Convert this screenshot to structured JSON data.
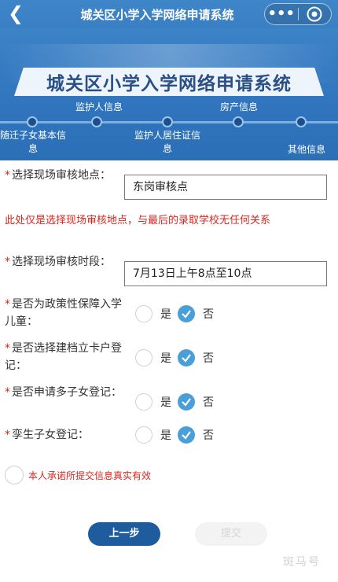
{
  "navbar": {
    "title": "城关区小学入学网络申请系统"
  },
  "banner": {
    "title": "城关区小学入学网络申请系统",
    "steps": [
      {
        "label": "随迁子女基本信息"
      },
      {
        "label": "监护人信息"
      },
      {
        "label": "监护人居住证信息"
      },
      {
        "label": "房产信息"
      },
      {
        "label": "其他信息"
      }
    ]
  },
  "form": {
    "site_label": "选择现场审核地点：",
    "site_value": "东岗审核点",
    "notice": "此处仅是选择现场审核地点，与最后的录取学校无任何关系",
    "time_label": "选择现场审核时段：",
    "time_value": "7月13日上午8点至10点",
    "yes_label": "是",
    "no_label": "否",
    "questions": [
      {
        "label": "是否为政策性保障入学儿童：",
        "selected": "否"
      },
      {
        "label": "是否选择建档立卡户登记：",
        "selected": "否"
      },
      {
        "label": "是否申请多子女登记：",
        "selected": "否"
      },
      {
        "label": "孪生子女登记：",
        "selected": "否"
      }
    ],
    "agree_text": "本人承诺所提交信息真实有效"
  },
  "buttons": {
    "prev": "上一步",
    "submit": "提交"
  },
  "watermark": "斑马号",
  "colors": {
    "primary": "#3a7fc3",
    "danger": "#d9261c",
    "check": "#4a9fd9",
    "button": "#1f5c9e"
  }
}
